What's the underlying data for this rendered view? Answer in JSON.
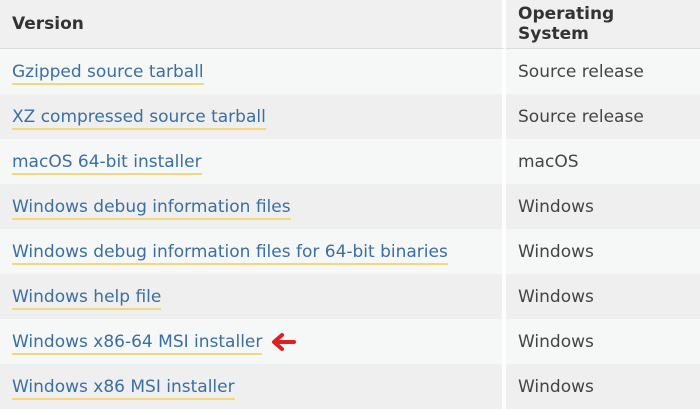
{
  "headers": {
    "version": "Version",
    "os": "Operating System"
  },
  "rows": [
    {
      "version": "Gzipped source tarball",
      "os": "Source release"
    },
    {
      "version": "XZ compressed source tarball",
      "os": "Source release"
    },
    {
      "version": "macOS 64-bit installer",
      "os": "macOS"
    },
    {
      "version": "Windows debug information files",
      "os": "Windows"
    },
    {
      "version": "Windows debug information files for 64-bit binaries",
      "os": "Windows"
    },
    {
      "version": "Windows help file",
      "os": "Windows"
    },
    {
      "version": "Windows x86-64 MSI installer",
      "os": "Windows",
      "highlighted": true
    },
    {
      "version": "Windows x86 MSI installer",
      "os": "Windows"
    }
  ],
  "colors": {
    "link": "#3a6fa0",
    "underline": "#f5d67a",
    "arrow": "#e02020"
  }
}
